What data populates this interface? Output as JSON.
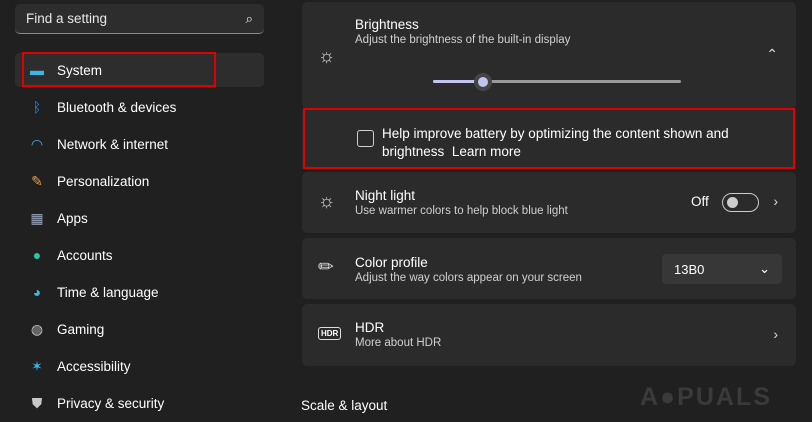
{
  "search": {
    "placeholder": "Find a setting"
  },
  "sidebar": {
    "items": [
      {
        "label": "System",
        "icon": "monitor-icon",
        "color": "#3cb6e8"
      },
      {
        "label": "Bluetooth & devices",
        "icon": "bluetooth-icon",
        "color": "#1e90ff"
      },
      {
        "label": "Network & internet",
        "icon": "wifi-icon",
        "color": "#3cb6e8"
      },
      {
        "label": "Personalization",
        "icon": "brush-icon",
        "color": "#e8a040"
      },
      {
        "label": "Apps",
        "icon": "apps-icon",
        "color": "#9aa8c0"
      },
      {
        "label": "Accounts",
        "icon": "person-icon",
        "color": "#2ec4a8"
      },
      {
        "label": "Time & language",
        "icon": "globe-clock-icon",
        "color": "#3cb6e8"
      },
      {
        "label": "Gaming",
        "icon": "gamepad-icon",
        "color": "#c8c8c8"
      },
      {
        "label": "Accessibility",
        "icon": "accessibility-icon",
        "color": "#3cb6e8"
      },
      {
        "label": "Privacy & security",
        "icon": "shield-icon",
        "color": "#c8c8c8"
      }
    ]
  },
  "brightness": {
    "title": "Brightness",
    "subtitle": "Adjust the brightness of the built-in display",
    "value_percent": 20
  },
  "battery": {
    "label": "Help improve battery by optimizing the content shown and brightness",
    "link": "Learn more",
    "checked": false
  },
  "night_light": {
    "title": "Night light",
    "subtitle": "Use warmer colors to help block blue light",
    "state": "Off"
  },
  "color_profile": {
    "title": "Color profile",
    "subtitle": "Adjust the way colors appear on your screen",
    "value": "13B0"
  },
  "hdr": {
    "title": "HDR",
    "subtitle": "More about HDR",
    "icon_text": "HDR"
  },
  "section": {
    "scale": "Scale & layout"
  },
  "watermark": "APPUALS"
}
